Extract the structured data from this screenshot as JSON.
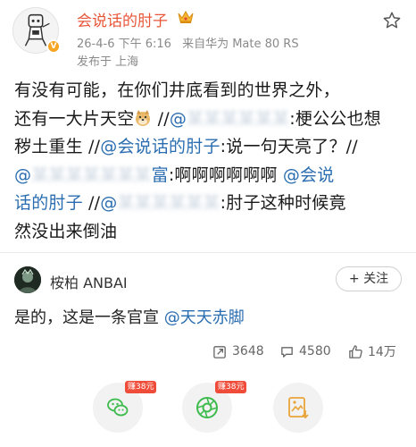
{
  "post": {
    "author": "会说话的肘子",
    "date": "26-4-6 下午 6:16",
    "source": "来自华为 Mate 80 RS",
    "location": "发布于 上海"
  },
  "body": {
    "line1": "有没有可能，在你们井底看到的世界之外，",
    "line2a": "还有一大片天空",
    "line2b": " //",
    "line2c": "@",
    "line2d": "梗公公也想",
    "line2e": ":梗公公也想",
    "line3a": "秽土重生 //",
    "line3b": "@会说话的肘子",
    "line3c": ":说一句天亮了？//",
    "line4a": "@",
    "line4b": "富",
    "line4c": ":啊啊啊啊啊啊 ",
    "line4d": "@会说",
    "line5a": "话的肘子",
    "line5b": " //",
    "line5c": "@",
    "line5d": ":肘子这种时候竟",
    "line6": "然没出来倒油"
  },
  "comment": {
    "user": "桉柏 ANBAI",
    "follow_label": "+ 关注",
    "text_plain": "是的，这是一条官宣 ",
    "text_mention": "@天天赤脚"
  },
  "stats": {
    "reposts": "3648",
    "comments": "4580",
    "likes": "14万"
  },
  "share": {
    "earn_wechat": "赚38元",
    "earn_moments": "赚38元"
  },
  "colors": {
    "author": "#e8563a",
    "mention": "#2a6db0",
    "earn_badge": "#f04c3a"
  }
}
